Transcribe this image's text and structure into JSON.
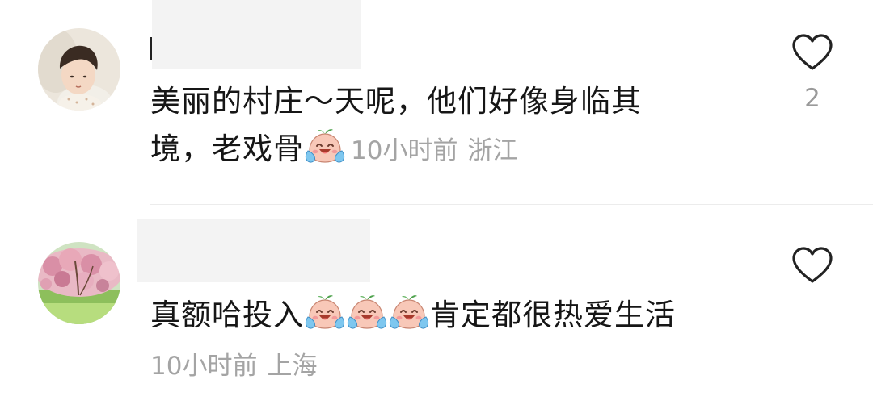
{
  "comments": [
    {
      "text_line1": "美丽的村庄～天呢，他们好像身临其",
      "text_line2": "境，老戏骨",
      "emoji": [
        "laugh-cry-emoji"
      ],
      "time": "10小时前",
      "location": "浙江",
      "like_count": "2",
      "icons": {
        "like": "heart-outline-icon"
      }
    },
    {
      "text_before": "真额哈投入",
      "emoji": [
        "laugh-cry-emoji",
        "laugh-cry-emoji",
        "laugh-cry-emoji"
      ],
      "text_after": "肯定都很热爱生活",
      "time": "10小时前",
      "location": "上海",
      "icons": {
        "like": "heart-outline-icon"
      }
    }
  ],
  "colors": {
    "text": "#161616",
    "meta": "#a4a4a4",
    "divider": "#ececec",
    "name_mask": "#f3f3f3"
  }
}
